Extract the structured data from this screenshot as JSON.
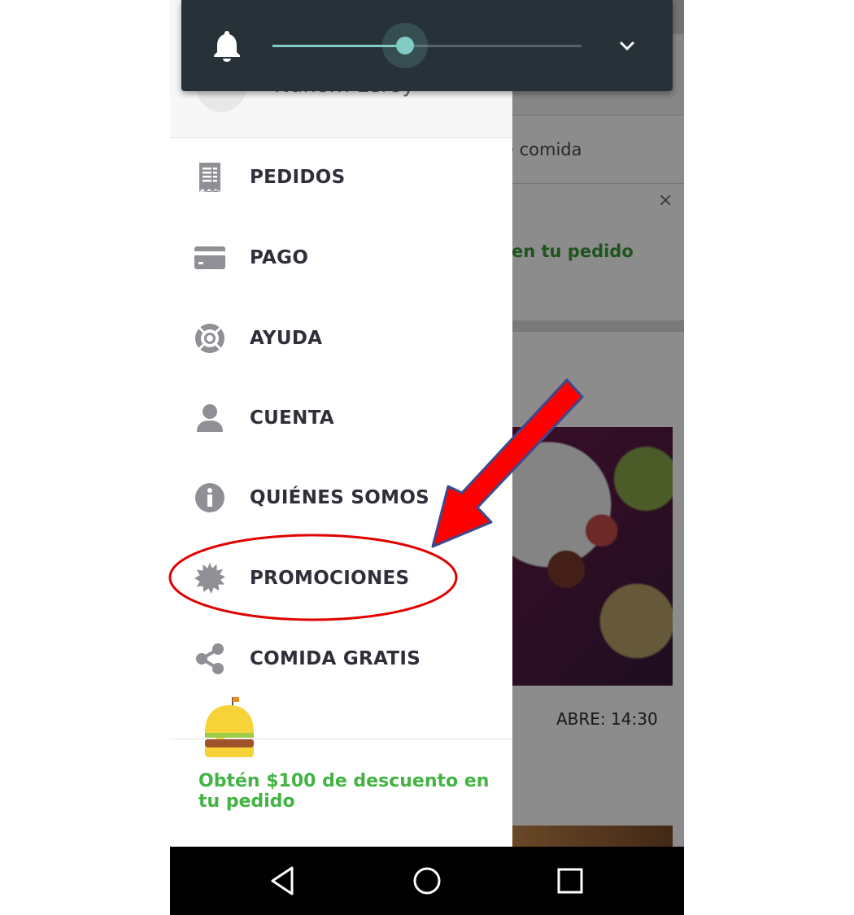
{
  "background": {
    "search_fragment": "e comida",
    "banner_fragment": "en tu pedido",
    "close_glyph": "×",
    "hours": "ABRE: 14:30"
  },
  "drawer": {
    "user_name": "Nahom Leroy",
    "menu": [
      {
        "label": "PEDIDOS",
        "icon": "receipt-icon"
      },
      {
        "label": "PAGO",
        "icon": "credit-card-icon"
      },
      {
        "label": "AYUDA",
        "icon": "lifebuoy-icon"
      },
      {
        "label": "CUENTA",
        "icon": "person-icon"
      },
      {
        "label": "QUIÉNES SOMOS",
        "icon": "info-icon"
      },
      {
        "label": "PROMOCIONES",
        "icon": "badge-icon"
      },
      {
        "label": "COMIDA GRATIS",
        "icon": "share-icon"
      }
    ],
    "promo": "Obtén $100 de descuento en tu pedido"
  },
  "volume_panel": {
    "level": 0.43,
    "icon": "bell-icon",
    "expand_icon": "chevron-down-icon"
  },
  "navbar": {
    "buttons": [
      "back-icon",
      "home-icon",
      "recents-icon"
    ]
  },
  "colors": {
    "panel": "#263238",
    "accent": "#80cbc4",
    "promo_green": "#43b343",
    "annotation_red": "#e00000"
  }
}
